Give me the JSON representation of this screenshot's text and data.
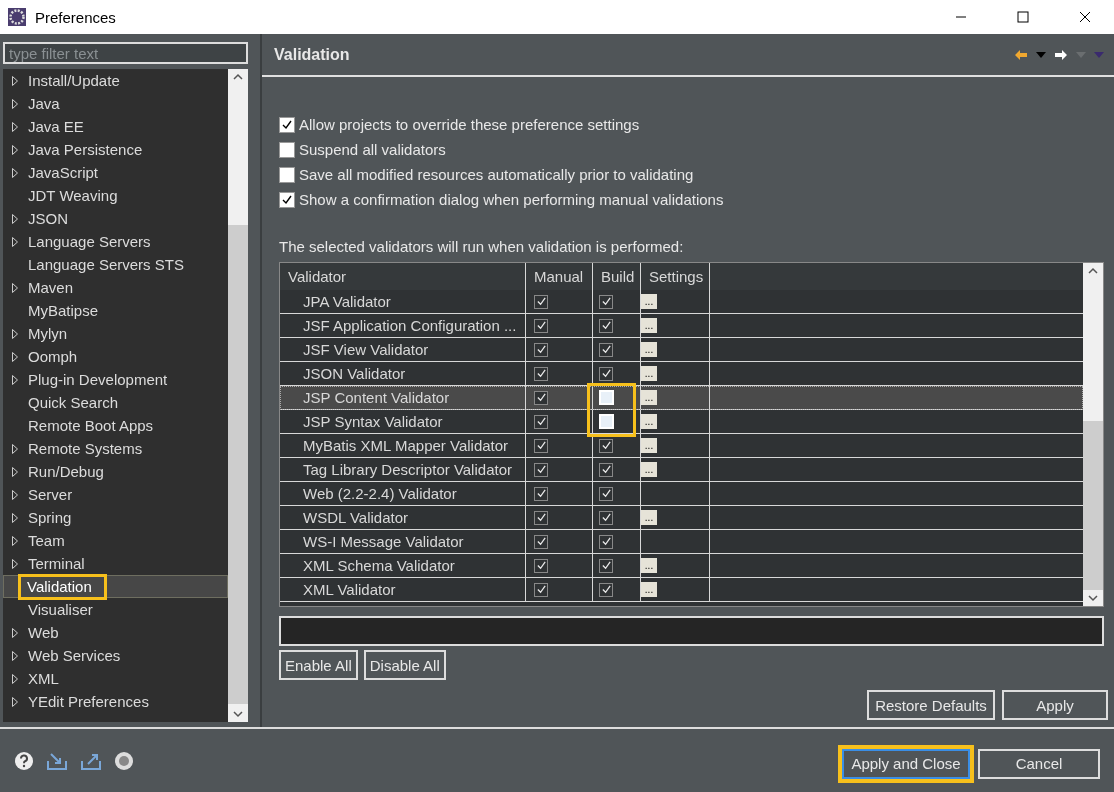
{
  "window": {
    "title": "Preferences"
  },
  "filter": {
    "placeholder": "type filter text"
  },
  "tree": [
    {
      "label": "Install/Update",
      "expandable": true,
      "selected": false
    },
    {
      "label": "Java",
      "expandable": true,
      "selected": false
    },
    {
      "label": "Java EE",
      "expandable": true,
      "selected": false
    },
    {
      "label": "Java Persistence",
      "expandable": true,
      "selected": false
    },
    {
      "label": "JavaScript",
      "expandable": true,
      "selected": false
    },
    {
      "label": "JDT Weaving",
      "expandable": false,
      "selected": false
    },
    {
      "label": "JSON",
      "expandable": true,
      "selected": false
    },
    {
      "label": "Language Servers",
      "expandable": true,
      "selected": false
    },
    {
      "label": "Language Servers STS",
      "expandable": false,
      "selected": false
    },
    {
      "label": "Maven",
      "expandable": true,
      "selected": false
    },
    {
      "label": "MyBatipse",
      "expandable": false,
      "selected": false
    },
    {
      "label": "Mylyn",
      "expandable": true,
      "selected": false
    },
    {
      "label": "Oomph",
      "expandable": true,
      "selected": false
    },
    {
      "label": "Plug-in Development",
      "expandable": true,
      "selected": false
    },
    {
      "label": "Quick Search",
      "expandable": false,
      "selected": false
    },
    {
      "label": "Remote Boot Apps",
      "expandable": false,
      "selected": false
    },
    {
      "label": "Remote Systems",
      "expandable": true,
      "selected": false
    },
    {
      "label": "Run/Debug",
      "expandable": true,
      "selected": false
    },
    {
      "label": "Server",
      "expandable": true,
      "selected": false
    },
    {
      "label": "Spring",
      "expandable": true,
      "selected": false
    },
    {
      "label": "Team",
      "expandable": true,
      "selected": false
    },
    {
      "label": "Terminal",
      "expandable": true,
      "selected": false
    },
    {
      "label": "Validation",
      "expandable": false,
      "selected": true
    },
    {
      "label": "Visualiser",
      "expandable": false,
      "selected": false
    },
    {
      "label": "Web",
      "expandable": true,
      "selected": false
    },
    {
      "label": "Web Services",
      "expandable": true,
      "selected": false
    },
    {
      "label": "XML",
      "expandable": true,
      "selected": false
    },
    {
      "label": "YEdit Preferences",
      "expandable": true,
      "selected": false
    }
  ],
  "page": {
    "title": "Validation"
  },
  "options": [
    {
      "label": "Allow projects to override these preference settings",
      "checked": true
    },
    {
      "label": "Suspend all validators",
      "checked": false
    },
    {
      "label": "Save all modified resources automatically prior to validating",
      "checked": false
    },
    {
      "label": "Show a confirmation dialog when performing manual validations",
      "checked": true
    }
  ],
  "table_caption": "The selected validators will run when validation is performed:",
  "table": {
    "columns": [
      "Validator",
      "Manual",
      "Build",
      "Settings"
    ],
    "rows": [
      {
        "name": "JPA Validator",
        "manual": true,
        "build": true,
        "settings": "...",
        "selected": false,
        "highlighted": false
      },
      {
        "name": "JSF Application Configuration ...",
        "manual": true,
        "build": true,
        "settings": "...",
        "selected": false,
        "highlighted": false
      },
      {
        "name": "JSF View Validator",
        "manual": true,
        "build": true,
        "settings": "...",
        "selected": false,
        "highlighted": false
      },
      {
        "name": "JSON Validator",
        "manual": true,
        "build": true,
        "settings": "...",
        "selected": false,
        "highlighted": false
      },
      {
        "name": "JSP Content Validator",
        "manual": true,
        "build": false,
        "settings": "...",
        "selected": true,
        "highlighted": true
      },
      {
        "name": "JSP Syntax Validator",
        "manual": true,
        "build": false,
        "settings": "...",
        "selected": false,
        "highlighted": true
      },
      {
        "name": "MyBatis XML Mapper Validator",
        "manual": true,
        "build": true,
        "settings": "...",
        "selected": false,
        "highlighted": false
      },
      {
        "name": "Tag Library Descriptor Validator",
        "manual": true,
        "build": true,
        "settings": "...",
        "selected": false,
        "highlighted": false
      },
      {
        "name": "Web (2.2-2.4) Validator",
        "manual": true,
        "build": true,
        "selected": false,
        "highlighted": false
      },
      {
        "name": "WSDL Validator",
        "manual": true,
        "build": true,
        "settings": "...",
        "selected": false,
        "highlighted": false
      },
      {
        "name": "WS-I Message Validator",
        "manual": true,
        "build": true,
        "selected": false,
        "highlighted": false
      },
      {
        "name": "XML Schema Validator",
        "manual": true,
        "build": true,
        "settings": "...",
        "selected": false,
        "highlighted": false
      },
      {
        "name": "XML Validator",
        "manual": true,
        "build": true,
        "settings": "...",
        "selected": false,
        "highlighted": false
      }
    ]
  },
  "table_buttons": [
    "Enable All",
    "Disable All"
  ],
  "page_buttons": [
    "Restore Defaults",
    "Apply"
  ],
  "dialog_buttons": [
    {
      "label": "Apply and Close",
      "highlighted": true
    },
    {
      "label": "Cancel",
      "highlighted": false
    }
  ]
}
